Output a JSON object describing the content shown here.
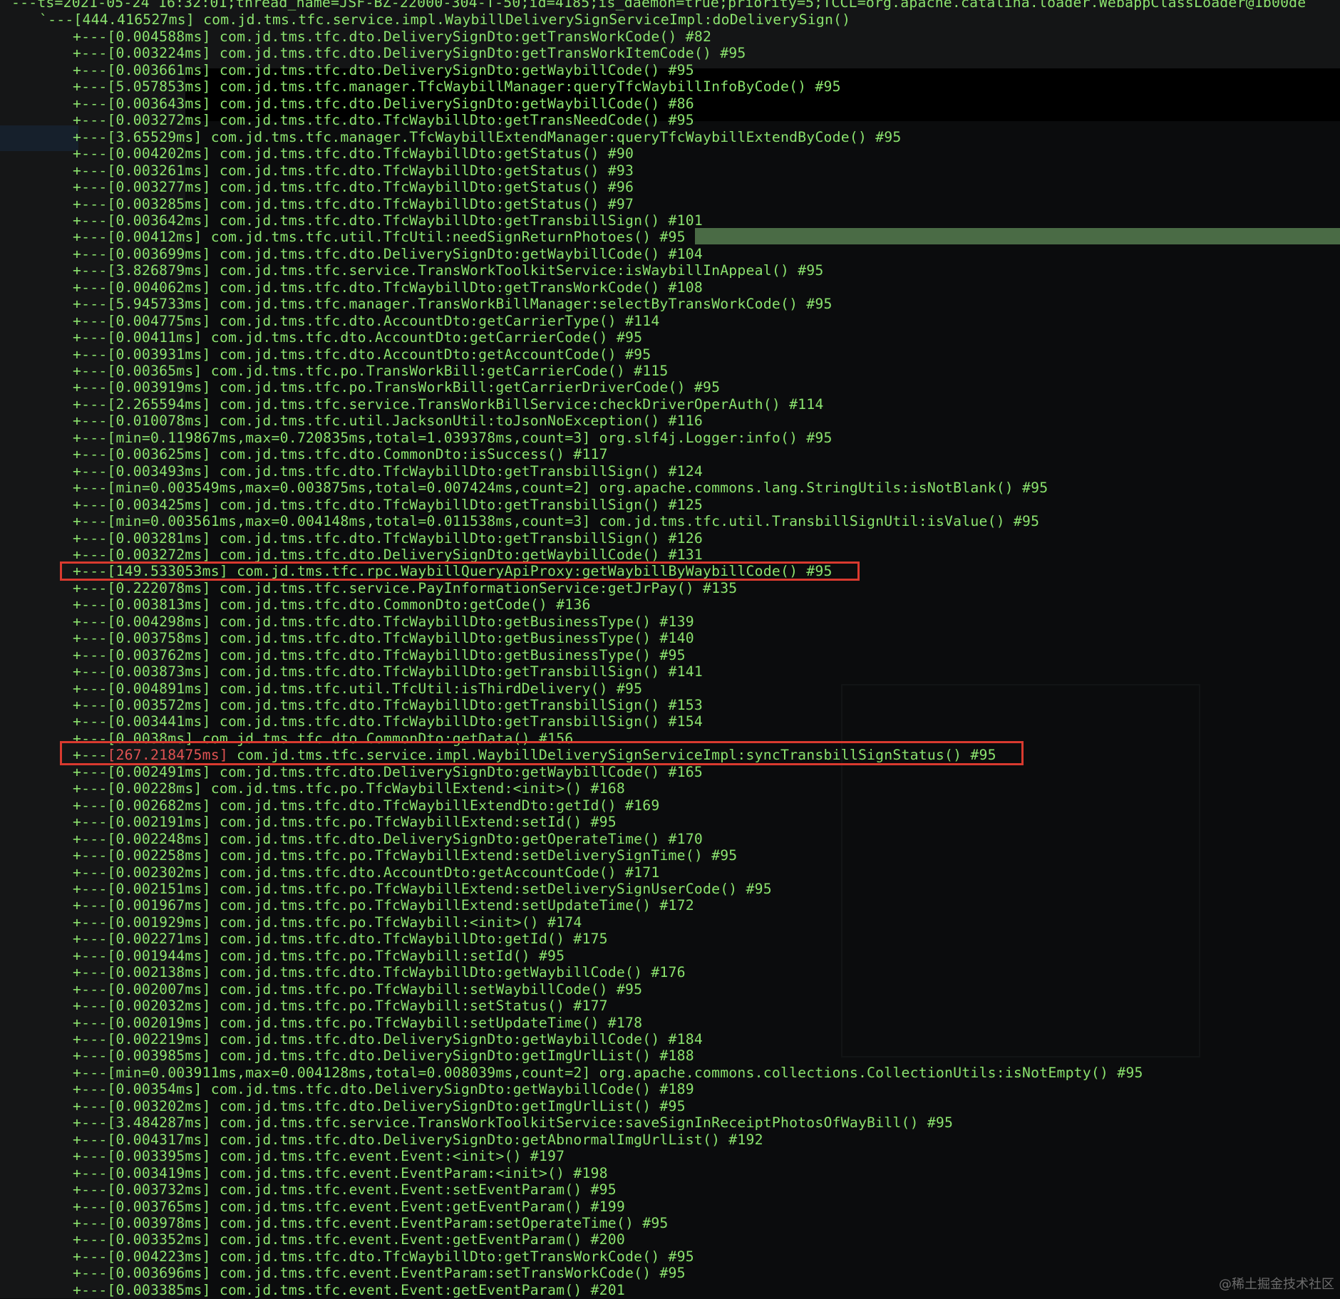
{
  "header": {
    "thread_line": "---ts=2021-05-24 16:32:01;thread_name=JSF-BZ-22000-304-T-50;id=4185;is_daemon=true;priority=5;TCCL=org.apache.catalina.loader.WebappClassLoader@1b00de",
    "root_line": "`---[444.416527ms] com.jd.tms.tfc.service.impl.WaybillDeliverySignServiceImpl:doDeliverySign()"
  },
  "trace": [
    "+---[0.004588ms] com.jd.tms.tfc.dto.DeliverySignDto:getTransWorkCode() #82",
    "+---[0.003224ms] com.jd.tms.tfc.dto.DeliverySignDto:getTransWorkItemCode() #95",
    "+---[0.003661ms] com.jd.tms.tfc.dto.DeliverySignDto:getWaybillCode() #95",
    "+---[5.057853ms] com.jd.tms.tfc.manager.TfcWaybillManager:queryTfcWaybillInfoByCode() #95",
    "+---[0.003643ms] com.jd.tms.tfc.dto.DeliverySignDto:getWaybillCode() #86",
    "+---[0.003272ms] com.jd.tms.tfc.dto.TfcWaybillDto:getTransNeedCode() #95",
    "+---[3.65529ms] com.jd.tms.tfc.manager.TfcWaybillExtendManager:queryTfcWaybillExtendByCode() #95",
    "+---[0.004202ms] com.jd.tms.tfc.dto.TfcWaybillDto:getStatus() #90",
    "+---[0.003261ms] com.jd.tms.tfc.dto.TfcWaybillDto:getStatus() #93",
    "+---[0.003277ms] com.jd.tms.tfc.dto.TfcWaybillDto:getStatus() #96",
    "+---[0.003285ms] com.jd.tms.tfc.dto.TfcWaybillDto:getStatus() #97",
    "+---[0.003642ms] com.jd.tms.tfc.dto.TfcWaybillDto:getTransbillSign() #101",
    "+---[0.00412ms] com.jd.tms.tfc.util.TfcUtil:needSignReturnPhotoes() #95",
    "+---[0.003699ms] com.jd.tms.tfc.dto.DeliverySignDto:getWaybillCode() #104",
    "+---[3.826879ms] com.jd.tms.tfc.service.TransWorkToolkitService:isWaybillInAppeal() #95",
    "+---[0.004062ms] com.jd.tms.tfc.dto.TfcWaybillDto:getTransWorkCode() #108",
    "+---[5.945733ms] com.jd.tms.tfc.manager.TransWorkBillManager:selectByTransWorkCode() #95",
    "+---[0.004775ms] com.jd.tms.tfc.dto.AccountDto:getCarrierType() #114",
    "+---[0.00411ms] com.jd.tms.tfc.dto.AccountDto:getCarrierCode() #95",
    "+---[0.003931ms] com.jd.tms.tfc.dto.AccountDto:getAccountCode() #95",
    "+---[0.00365ms] com.jd.tms.tfc.po.TransWorkBill:getCarrierCode() #115",
    "+---[0.003919ms] com.jd.tms.tfc.po.TransWorkBill:getCarrierDriverCode() #95",
    "+---[2.265594ms] com.jd.tms.tfc.service.TransWorkBillService:checkDriverOperAuth() #114",
    "+---[0.010078ms] com.jd.tms.tfc.util.JacksonUtil:toJsonNoException() #116",
    "+---[min=0.119867ms,max=0.720835ms,total=1.039378ms,count=3] org.slf4j.Logger:info() #95",
    "+---[0.003625ms] com.jd.tms.tfc.dto.CommonDto:isSuccess() #117",
    "+---[0.003493ms] com.jd.tms.tfc.dto.TfcWaybillDto:getTransbillSign() #124",
    "+---[min=0.003549ms,max=0.003875ms,total=0.007424ms,count=2] org.apache.commons.lang.StringUtils:isNotBlank() #95",
    "+---[0.003425ms] com.jd.tms.tfc.dto.TfcWaybillDto:getTransbillSign() #125",
    "+---[min=0.003561ms,max=0.004148ms,total=0.011538ms,count=3] com.jd.tms.tfc.util.TransbillSignUtil:isValue() #95",
    "+---[0.003281ms] com.jd.tms.tfc.dto.TfcWaybillDto:getTransbillSign() #126",
    "+---[0.003272ms] com.jd.tms.tfc.dto.DeliverySignDto:getWaybillCode() #131",
    "+---[149.533053ms] com.jd.tms.tfc.rpc.WaybillQueryApiProxy:getWaybillByWaybillCode() #95",
    "+---[0.222078ms] com.jd.tms.tfc.service.PayInformationService:getJrPay() #135",
    "+---[0.003813ms] com.jd.tms.tfc.dto.CommonDto:getCode() #136",
    "+---[0.004298ms] com.jd.tms.tfc.dto.TfcWaybillDto:getBusinessType() #139",
    "+---[0.003758ms] com.jd.tms.tfc.dto.TfcWaybillDto:getBusinessType() #140",
    "+---[0.003762ms] com.jd.tms.tfc.dto.TfcWaybillDto:getBusinessType() #95",
    "+---[0.003873ms] com.jd.tms.tfc.dto.TfcWaybillDto:getTransbillSign() #141",
    "+---[0.004891ms] com.jd.tms.tfc.util.TfcUtil:isThirdDelivery() #95",
    "+---[0.003572ms] com.jd.tms.tfc.dto.TfcWaybillDto:getTransbillSign() #153",
    "+---[0.003441ms] com.jd.tms.tfc.dto.TfcWaybillDto:getTransbillSign() #154",
    "+---[0.0038ms] com.jd.tms.tfc.dto.CommonDto:getData() #156",
    "+---[267.218475ms] com.jd.tms.tfc.service.impl.WaybillDeliverySignServiceImpl:syncTransbillSignStatus() #95",
    "+---[0.002491ms] com.jd.tms.tfc.dto.DeliverySignDto:getWaybillCode() #165",
    "+---[0.00228ms] com.jd.tms.tfc.po.TfcWaybillExtend:<init>() #168",
    "+---[0.002682ms] com.jd.tms.tfc.dto.TfcWaybillExtendDto:getId() #169",
    "+---[0.002191ms] com.jd.tms.tfc.po.TfcWaybillExtend:setId() #95",
    "+---[0.002248ms] com.jd.tms.tfc.dto.DeliverySignDto:getOperateTime() #170",
    "+---[0.002258ms] com.jd.tms.tfc.po.TfcWaybillExtend:setDeliverySignTime() #95",
    "+---[0.002302ms] com.jd.tms.tfc.dto.AccountDto:getAccountCode() #171",
    "+---[0.002151ms] com.jd.tms.tfc.po.TfcWaybillExtend:setDeliverySignUserCode() #95",
    "+---[0.001967ms] com.jd.tms.tfc.po.TfcWaybillExtend:setUpdateTime() #172",
    "+---[0.001929ms] com.jd.tms.tfc.po.TfcWaybill:<init>() #174",
    "+---[0.002271ms] com.jd.tms.tfc.dto.TfcWaybillDto:getId() #175",
    "+---[0.001944ms] com.jd.tms.tfc.po.TfcWaybill:setId() #95",
    "+---[0.002138ms] com.jd.tms.tfc.dto.TfcWaybillDto:getWaybillCode() #176",
    "+---[0.002007ms] com.jd.tms.tfc.po.TfcWaybill:setWaybillCode() #95",
    "+---[0.002032ms] com.jd.tms.tfc.po.TfcWaybill:setStatus() #177",
    "+---[0.002019ms] com.jd.tms.tfc.po.TfcWaybill:setUpdateTime() #178",
    "+---[0.002219ms] com.jd.tms.tfc.dto.DeliverySignDto:getWaybillCode() #184",
    "+---[0.003985ms] com.jd.tms.tfc.dto.DeliverySignDto:getImgUrlList() #188",
    "+---[min=0.003911ms,max=0.004128ms,total=0.008039ms,count=2] org.apache.commons.collections.CollectionUtils:isNotEmpty() #95",
    "+---[0.00354ms] com.jd.tms.tfc.dto.DeliverySignDto:getWaybillCode() #189",
    "+---[0.003202ms] com.jd.tms.tfc.dto.DeliverySignDto:getImgUrlList() #95",
    "+---[3.484287ms] com.jd.tms.tfc.service.TransWorkToolkitService:saveSignInReceiptPhotosOfWayBill() #95",
    "+---[0.004317ms] com.jd.tms.tfc.dto.DeliverySignDto:getAbnormalImgUrlList() #192",
    "+---[0.003395ms] com.jd.tms.tfc.event.Event:<init>() #197",
    "+---[0.003419ms] com.jd.tms.tfc.event.EventParam:<init>() #198",
    "+---[0.003732ms] com.jd.tms.tfc.event.Event:setEventParam() #95",
    "+---[0.003765ms] com.jd.tms.tfc.event.Event:getEventParam() #199",
    "+---[0.003978ms] com.jd.tms.tfc.event.EventParam:setOperateTime() #95",
    "+---[0.003352ms] com.jd.tms.tfc.event.Event:getEventParam() #200",
    "+---[0.004223ms] com.jd.tms.tfc.dto.TfcWaybillDto:getTransWorkCode() #95",
    "+---[0.003696ms] com.jd.tms.tfc.event.EventParam:setTransWorkCode() #95",
    "+---[0.003385ms] com.jd.tms.tfc.event.Event:getEventParam() #201"
  ],
  "highlights": {
    "box1_index": 32,
    "box2_index": 43,
    "red_time_text": "267.218475ms"
  },
  "watermark": "@稀土掘金技术社区",
  "colors": {
    "text": "#8be36e",
    "highlight_box": "#d93a2f",
    "red_time": "#e05252",
    "background": "#0b0c0d"
  }
}
